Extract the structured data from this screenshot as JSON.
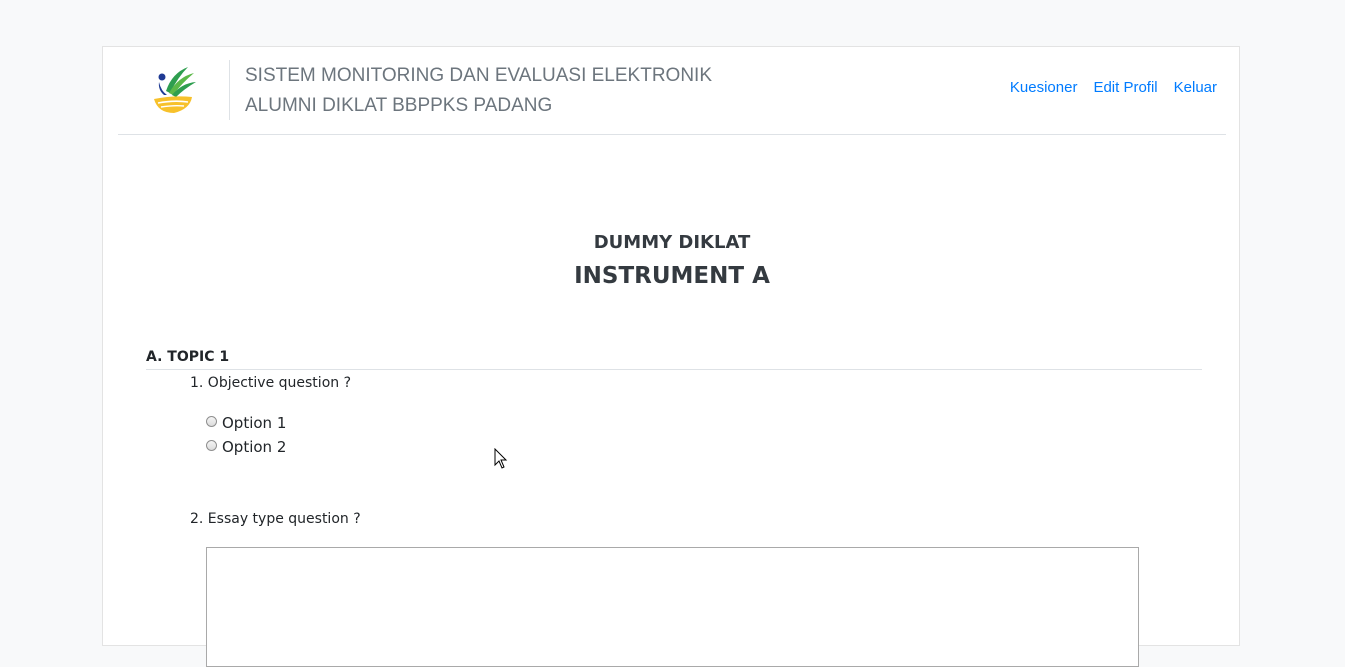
{
  "header": {
    "brand_line1": "SISTEM MONITORING DAN EVALUASI ELEKTRONIK",
    "brand_line2": "ALUMNI DIKLAT BBPPKS PADANG",
    "nav": [
      {
        "label": "Kuesioner"
      },
      {
        "label": "Edit Profil"
      },
      {
        "label": "Keluar"
      }
    ],
    "logo_icon": "ministry-logo-icon"
  },
  "page": {
    "subtitle": "DUMMY DIKLAT",
    "title": "INSTRUMENT A"
  },
  "sections": [
    {
      "title": "A. TOPIC 1",
      "questions": [
        {
          "text": "1. Objective question ?",
          "options": [
            "Option 1",
            "Option 2"
          ]
        },
        {
          "text": "2. Essay type question ?",
          "answer": ""
        }
      ]
    }
  ],
  "colors": {
    "link": "#007bff",
    "brand_text": "#6c757d",
    "background": "#f8f9fa"
  }
}
